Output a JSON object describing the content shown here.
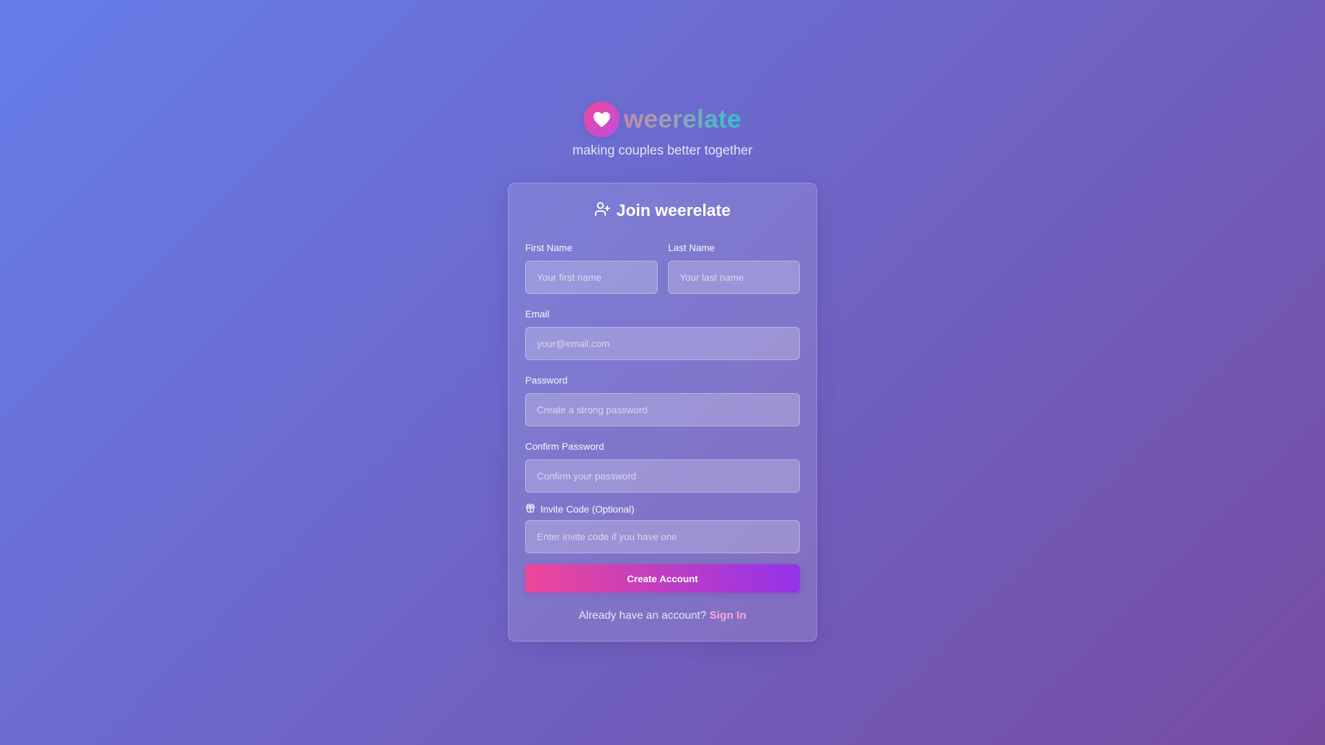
{
  "brand": {
    "name": "weerelate",
    "tagline": "making couples better together",
    "logo_icon": "heart-icon",
    "logo_gradient": [
      "#ec4899",
      "#c04ee0"
    ],
    "name_gradient": [
      "#c98aa8",
      "#2ec4c8"
    ]
  },
  "form": {
    "title": "Join weerelate",
    "title_icon": "user-plus-icon",
    "first_name": {
      "label": "First Name",
      "placeholder": "Your first name",
      "value": ""
    },
    "last_name": {
      "label": "Last Name",
      "placeholder": "Your last name",
      "value": ""
    },
    "email": {
      "label": "Email",
      "placeholder": "your@email.com",
      "value": ""
    },
    "password": {
      "label": "Password",
      "placeholder": "Create a strong password",
      "value": ""
    },
    "confirm_password": {
      "label": "Confirm Password",
      "placeholder": "Confirm your password",
      "value": ""
    },
    "invite_code": {
      "label": "Invite Code (Optional)",
      "icon": "gift-icon",
      "placeholder": "Enter invite code if you have one",
      "value": ""
    },
    "submit_label": "Create Account",
    "footer_text": "Already have an account?",
    "signin_label": "Sign In"
  },
  "colors": {
    "background_start": "#667eea",
    "background_end": "#764ba2",
    "button_start": "#ec4899",
    "button_end": "#9333ea",
    "link": "#f9a8d4"
  }
}
